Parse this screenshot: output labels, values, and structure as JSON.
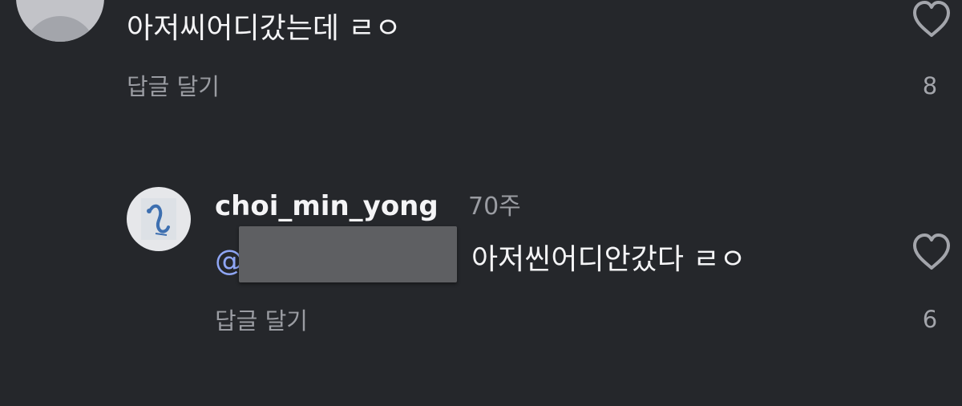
{
  "comment1": {
    "text": "아저씨어디갔는데 ㄹㅇ",
    "reply_label": "답글 달기",
    "like_count": "8"
  },
  "comment2": {
    "username": "choi_min_yong",
    "time": "70주",
    "mention_symbol": "@",
    "text": "아저씬어디안갔다 ㄹㅇ",
    "reply_label": "답글 달기",
    "like_count": "6"
  },
  "icons": {
    "like": "heart-outline-icon",
    "avatar": "default-avatar-icon"
  },
  "colors": {
    "background": "#25272b",
    "text_primary": "#f4f4f6",
    "text_secondary": "#9a9ca2",
    "mention": "#8fa6f5"
  }
}
